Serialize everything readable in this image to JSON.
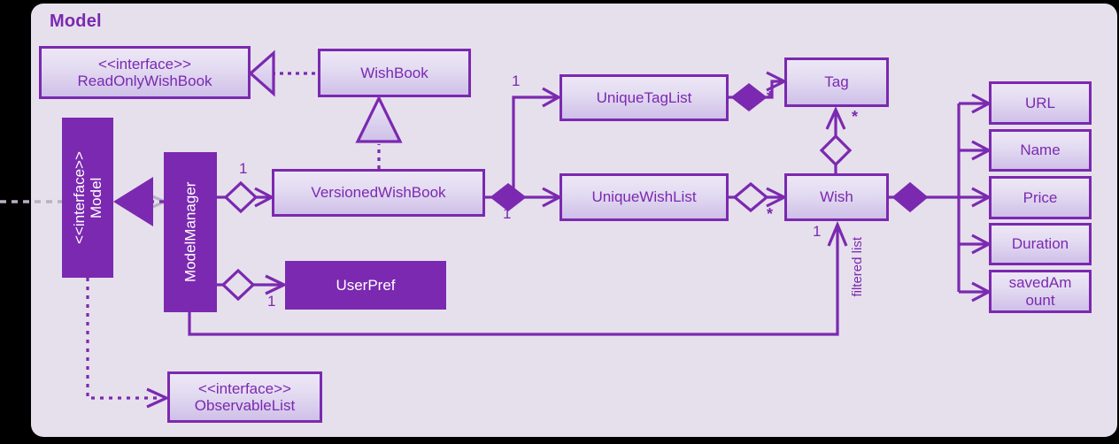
{
  "panel": {
    "title": "Model",
    "bg_color": "#e6e0ec",
    "accent_color": "#7b29b0"
  },
  "classes": {
    "read_only_wish_book": {
      "stereotype": "<<interface>>",
      "name": "ReadOnlyWishBook"
    },
    "wish_book": {
      "name": "WishBook"
    },
    "model": {
      "stereotype": "<<interface>>",
      "name": "Model"
    },
    "model_manager": {
      "name": "ModelManager"
    },
    "versioned_wish_book": {
      "name": "VersionedWishBook"
    },
    "user_pref": {
      "name": "UserPref"
    },
    "observable_list": {
      "stereotype": "<<interface>>",
      "name": "ObservableList"
    },
    "unique_tag_list": {
      "name": "UniqueTagList"
    },
    "unique_wish_list": {
      "name": "UniqueWishList"
    },
    "tag": {
      "name": "Tag"
    },
    "wish": {
      "name": "Wish"
    }
  },
  "attributes": [
    {
      "name": "URL"
    },
    {
      "name": "Name"
    },
    {
      "name": "Price"
    },
    {
      "name": "Duration"
    },
    {
      "name": "savedAm",
      "name2": "ount"
    }
  ],
  "multiplicities": {
    "mm_to_vwb": "1",
    "mm_to_userpref": "1",
    "vwb_to_utl": "1",
    "vwb_to_uwl": "1",
    "utl_to_tag": "*",
    "tag_from_wish": "*",
    "uwl_to_wish": "*",
    "wish_filtered": "1"
  },
  "edge_labels": {
    "filtered_list": "filtered list"
  }
}
